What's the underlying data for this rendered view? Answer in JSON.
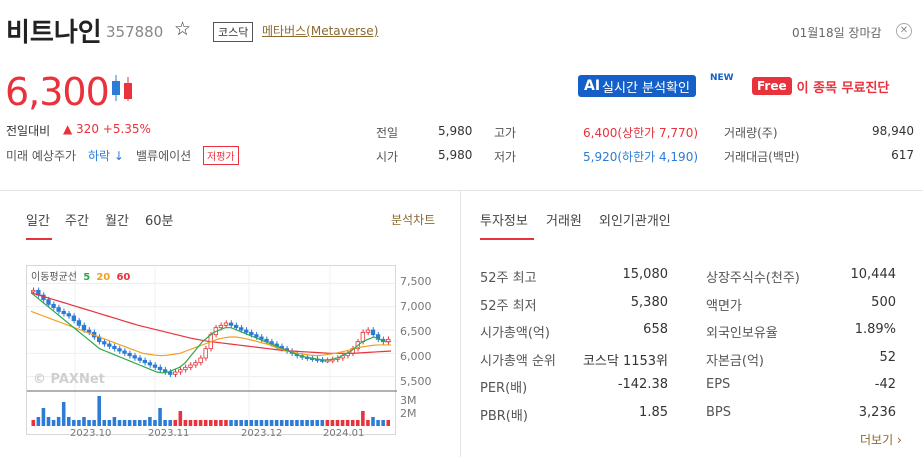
{
  "header": {
    "stock_name": "비트나인",
    "stock_code": "357880",
    "market_tag": "코스닥",
    "theme_link": "메타버스(Metaverse)",
    "market_status": "01월18일 장마감",
    "star_icon": "star-icon",
    "close_icon": "close-circle-icon"
  },
  "price": {
    "current": "6,300",
    "change_label": "전일대비",
    "change_value": "▲ 320 +5.35%",
    "forecast_label": "미래 예상주가",
    "forecast_value": "하락",
    "forecast_arrow": "↓",
    "valuation_label": "밸류에이션",
    "valuation_tag": "저평가"
  },
  "promo": {
    "ai_badge": "AI",
    "ai_text": "실시간 분석확인",
    "new_label": "NEW",
    "free_badge": "Free",
    "free_text": "이 종목 무료진단"
  },
  "quote": [
    {
      "label": "전일",
      "value": "5,980"
    },
    {
      "label": "시가",
      "value": "5,980"
    },
    {
      "label": "고가",
      "value": "6,400(상한가 7,770)"
    },
    {
      "label": "저가",
      "value": "5,920(하한가 4,190)"
    },
    {
      "label": "거래량(주)",
      "value": "98,940"
    },
    {
      "label": "거래대금(백만)",
      "value": "617"
    }
  ],
  "chart_tabs": [
    "일간",
    "주간",
    "월간",
    "60분"
  ],
  "chart_link": "분석차트",
  "info_tabs": [
    "투자정보",
    "거래원",
    "외인기관개인"
  ],
  "more_link": "더보기",
  "invest_left": [
    {
      "label": "52주 최고",
      "value": "15,080"
    },
    {
      "label": "52주 최저",
      "value": "5,380"
    },
    {
      "label": "시가총액(억)",
      "value": "658"
    },
    {
      "label": "시가총액 순위",
      "value": "코스닥 1153위"
    },
    {
      "label": "PER(배)",
      "value": "-142.38"
    },
    {
      "label": "PBR(배)",
      "value": "1.85"
    }
  ],
  "invest_right": [
    {
      "label": "상장주식수(천주)",
      "value": "10,444"
    },
    {
      "label": "액면가",
      "value": "500"
    },
    {
      "label": "외국인보유율",
      "value": "1.89%"
    },
    {
      "label": "자본금(억)",
      "value": "52"
    },
    {
      "label": "EPS",
      "value": "-42"
    },
    {
      "label": "BPS",
      "value": "3,236"
    }
  ],
  "chart_data": {
    "type": "line",
    "legend_title": "이동평균선",
    "ma_labels": [
      "5",
      "20",
      "60"
    ],
    "ma_colors": [
      "#2ea84a",
      "#f0a020",
      "#e8323c"
    ],
    "watermark": "PAXNet",
    "y_ticks": [
      "7,500",
      "7,000",
      "6,500",
      "6,000",
      "5,500"
    ],
    "ylim": [
      5300,
      7700
    ],
    "vol_ticks": [
      "3M",
      "2M"
    ],
    "x_labels": [
      "2023.10",
      "2023.11",
      "2023.12",
      "2024.01"
    ],
    "candles": [
      7350,
      7250,
      7150,
      7050,
      6980,
      6900,
      6850,
      6800,
      6700,
      6600,
      6500,
      6450,
      6350,
      6250,
      6200,
      6150,
      6100,
      6050,
      6000,
      5950,
      5900,
      5850,
      5800,
      5750,
      5700,
      5650,
      5600,
      5550,
      5600,
      5650,
      5700,
      5750,
      5800,
      5900,
      6100,
      6400,
      6550,
      6600,
      6650,
      6600,
      6550,
      6500,
      6450,
      6400,
      6350,
      6300,
      6250,
      6200,
      6150,
      6100,
      6050,
      6000,
      5950,
      5920,
      5900,
      5880,
      5860,
      5850,
      5850,
      5870,
      5900,
      5950,
      6000,
      6100,
      6250,
      6450,
      6500,
      6400,
      6300,
      6250,
      6300
    ],
    "ma5": [
      7300,
      7200,
      7100,
      7000,
      6900,
      6800,
      6700,
      6600,
      6500,
      6400,
      6300,
      6200,
      6100,
      6050,
      6000,
      5950,
      5900,
      5850,
      5800,
      5750,
      5700,
      5650,
      5600,
      5580,
      5600,
      5650,
      5700,
      5800,
      5950,
      6100,
      6250,
      6350,
      6450,
      6500,
      6550,
      6550,
      6500,
      6450,
      6400,
      6350,
      6300,
      6250,
      6200,
      6150,
      6100,
      6050,
      6000,
      5950,
      5920,
      5900,
      5880,
      5860,
      5860,
      5880,
      5920,
      5980,
      6050,
      6150,
      6250,
      6300,
      6350,
      6300,
      6250,
      6250
    ],
    "ma20": [
      6900,
      6850,
      6800,
      6750,
      6700,
      6650,
      6600,
      6550,
      6500,
      6450,
      6400,
      6350,
      6300,
      6250,
      6200,
      6150,
      6100,
      6050,
      6000,
      5980,
      5960,
      5950,
      5960,
      5980,
      6000,
      6050,
      6100,
      6150,
      6200,
      6250,
      6300,
      6330,
      6350,
      6350,
      6330,
      6300,
      6270,
      6230,
      6200,
      6150,
      6100,
      6060,
      6030,
      6000,
      5980,
      5960,
      5950,
      5960,
      5980,
      6000,
      6030,
      6060,
      6100,
      6130,
      6150,
      6170,
      6180,
      6180,
      6180
    ],
    "ma60": [
      7300,
      7250,
      7200,
      7150,
      7100,
      7050,
      7000,
      6950,
      6900,
      6850,
      6800,
      6750,
      6700,
      6650,
      6600,
      6560,
      6520,
      6480,
      6440,
      6400,
      6360,
      6320,
      6290,
      6260,
      6240,
      6220,
      6200,
      6180,
      6160,
      6140,
      6120,
      6100,
      6080,
      6060,
      6050,
      6040,
      6030,
      6020,
      6010,
      6000,
      6000,
      6000,
      6000,
      6010,
      6020,
      6030,
      6040,
      6050
    ],
    "volume": [
      0.2,
      0.3,
      0.6,
      0.3,
      0.2,
      0.3,
      0.8,
      0.3,
      0.2,
      0.2,
      0.3,
      0.2,
      0.2,
      1.0,
      0.2,
      0.2,
      0.3,
      0.2,
      0.2,
      0.2,
      0.2,
      0.2,
      0.2,
      0.3,
      0.2,
      0.6,
      0.2,
      0.2,
      0.2,
      0.5,
      0.2,
      0.2,
      0.2,
      0.2,
      0.2,
      0.2,
      0.2,
      0.2,
      0.2,
      0.2,
      0.2,
      0.2,
      0.2,
      0.2,
      0.2,
      0.2,
      0.2,
      0.2,
      0.2,
      0.2,
      0.2,
      0.2,
      0.2,
      0.2,
      0.2,
      0.2,
      0.2,
      0.2,
      0.2,
      0.2,
      0.2,
      0.2,
      0.2,
      0.2,
      0.2,
      0.5,
      0.2,
      0.3,
      0.2,
      0.2,
      0.2
    ]
  }
}
